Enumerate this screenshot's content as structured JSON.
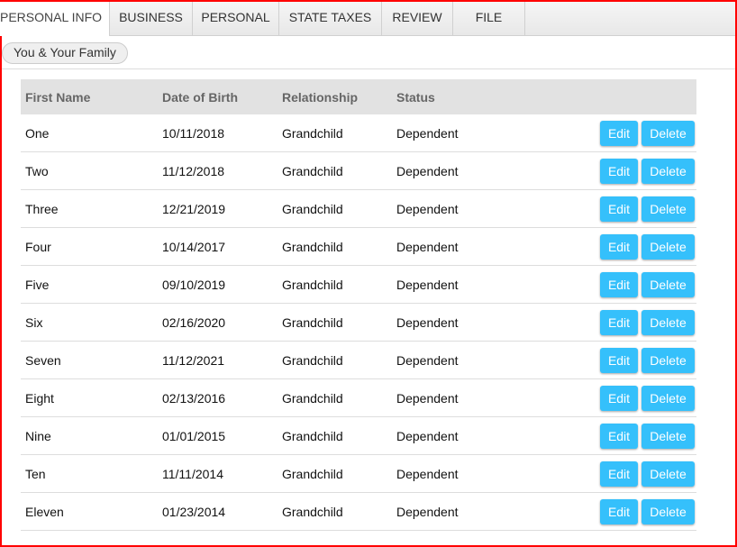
{
  "tabs": [
    {
      "label": "PERSONAL INFO",
      "active": true
    },
    {
      "label": "BUSINESS"
    },
    {
      "label": "PERSONAL"
    },
    {
      "label": "STATE TAXES"
    },
    {
      "label": "REVIEW"
    },
    {
      "label": "FILE"
    }
  ],
  "subnav": {
    "label": "You & Your Family"
  },
  "table": {
    "headers": [
      "First Name",
      "Date of Birth",
      "Relationship",
      "Status"
    ],
    "edit_label": "Edit",
    "delete_label": "Delete",
    "rows": [
      [
        "One",
        "10/11/2018",
        "Grandchild",
        "Dependent"
      ],
      [
        "Two",
        "11/12/2018",
        "Grandchild",
        "Dependent"
      ],
      [
        "Three",
        "12/21/2019",
        "Grandchild",
        "Dependent"
      ],
      [
        "Four",
        "10/14/2017",
        "Grandchild",
        "Dependent"
      ],
      [
        "Five",
        "09/10/2019",
        "Grandchild",
        "Dependent"
      ],
      [
        "Six",
        "02/16/2020",
        "Grandchild",
        "Dependent"
      ],
      [
        "Seven",
        "11/12/2021",
        "Grandchild",
        "Dependent"
      ],
      [
        "Eight",
        "02/13/2016",
        "Grandchild",
        "Dependent"
      ],
      [
        "Nine",
        "01/01/2015",
        "Grandchild",
        "Dependent"
      ],
      [
        "Ten",
        "11/11/2014",
        "Grandchild",
        "Dependent"
      ],
      [
        "Eleven",
        "01/23/2014",
        "Grandchild",
        "Dependent"
      ]
    ]
  }
}
